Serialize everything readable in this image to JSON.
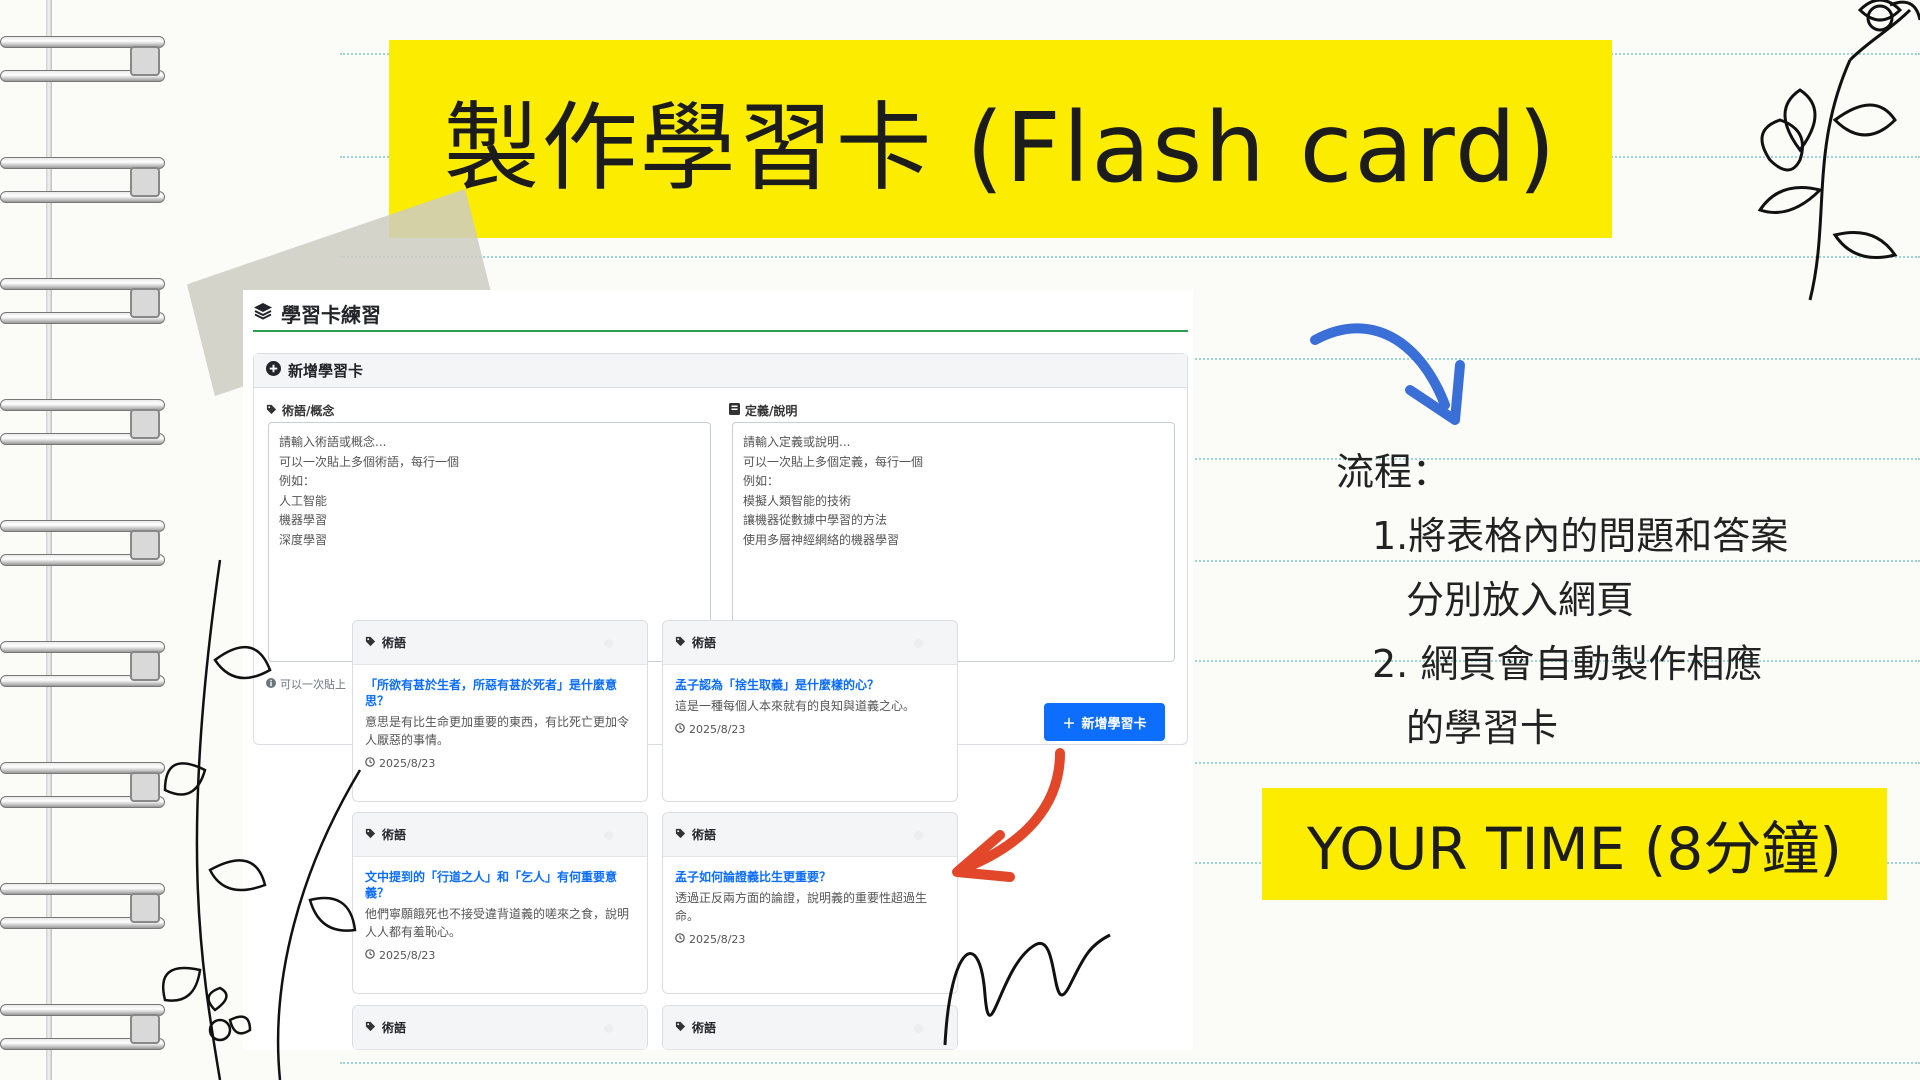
{
  "title": "製作學習卡 (Flash card)",
  "app": {
    "header_title": "學習卡練習",
    "form": {
      "header": "新增學習卡",
      "term_label": "術語/概念",
      "term_placeholder": "請輸入術語或概念...\n可以一次貼上多個術語，每行一個\n例如：\n人工智能\n機器學習\n深度學習",
      "definition_label": "定義/說明",
      "definition_placeholder": "請輸入定義或說明...\n可以一次貼上多個定義，每行一個\n例如：\n模擬人類智能的技術\n讓機器從數據中學習的方法\n使用多層神經網絡的機器學習",
      "hint": "可以一次貼上",
      "add_button": "新增學習卡"
    },
    "cards": [
      {
        "tag": "術語",
        "question": "「所欲有甚於生者，所惡有甚於死者」是什麼意思？",
        "answer": "意思是有比生命更加重要的東西，有比死亡更加令人厭惡的事情。",
        "date": "2025/8/23"
      },
      {
        "tag": "術語",
        "question": "孟子認為「捨生取義」是什麼樣的心？",
        "answer": "這是一種每個人本來就有的良知與道義之心。",
        "date": "2025/8/23"
      },
      {
        "tag": "術語",
        "question": "文中提到的「行道之人」和「乞人」有何重要意義？",
        "answer": "他們寧願餓死也不接受違背道義的嗟來之食，說明人人都有羞恥心。",
        "date": "2025/8/23"
      },
      {
        "tag": "術語",
        "question": "孟子如何論證義比生更重要？",
        "answer": "透過正反兩方面的論證，說明義的重要性超過生命。",
        "date": "2025/8/23"
      },
      {
        "tag": "術語"
      },
      {
        "tag": "術語"
      }
    ]
  },
  "process": {
    "heading": "流程：",
    "step1_line1": "1.將表格內的問題和答案",
    "step1_line2": "分別放入網頁",
    "step2_line1": "2. 網頁會自動製作相應",
    "step2_line2": "的學習卡"
  },
  "time_banner": "YOUR  TIME (8分鐘)",
  "colors": {
    "banner_yellow": "#fbec00",
    "accent_blue": "#0d6efd",
    "arrow_blue": "#3a6fd8",
    "arrow_red": "#e2472a",
    "divider_green": "#2e9e4d",
    "lines": "#9fd6cf"
  },
  "icons": [
    "layers-icon",
    "plus-circle-icon",
    "tag-icon",
    "book-icon",
    "info-icon",
    "clock-icon",
    "plus-icon"
  ]
}
